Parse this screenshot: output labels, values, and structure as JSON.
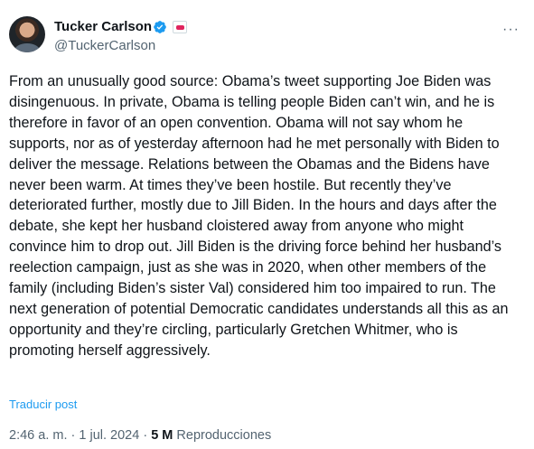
{
  "author": {
    "name": "Tucker Carlson",
    "handle": "@TuckerCarlson",
    "avatar_icon": "profile-photo",
    "verified_icon": "verified-badge-icon",
    "affiliate_icon": "affiliate-badge-icon"
  },
  "more_label": "···",
  "tweet_text": "From an unusually good source: Obama’s tweet supporting Joe Biden was disingenuous. In private, Obama is telling people Biden can’t win, and he is therefore in favor of an open convention. Obama will not say whom he supports, nor as of yesterday afternoon had he met personally with Biden to deliver the message. Relations between the Obamas and the Bidens have never been warm. At times they’ve been hostile. But recently they’ve deteriorated further, mostly due to Jill Biden. In the hours and days after the debate, she kept her husband cloistered away from anyone who might convince him to drop out. Jill Biden is the driving force behind her husband’s reelection campaign, just as she was in 2020, when other members of the family (including Biden’s sister Val) considered him too impaired to run. The next generation of potential Democratic candidates understands all this as an opportunity and they’re circling, particularly Gretchen Whitmer, who is promoting herself aggressively.",
  "translate_label": "Traducir post",
  "meta": {
    "time": "2:46 a. m.",
    "separator": "·",
    "date": "1 jul. 2024",
    "views_count": "5 M",
    "views_label": "Reproducciones"
  },
  "colors": {
    "link": "#1d9bf0",
    "secondary_text": "#536471",
    "primary_text": "#0f1419"
  }
}
